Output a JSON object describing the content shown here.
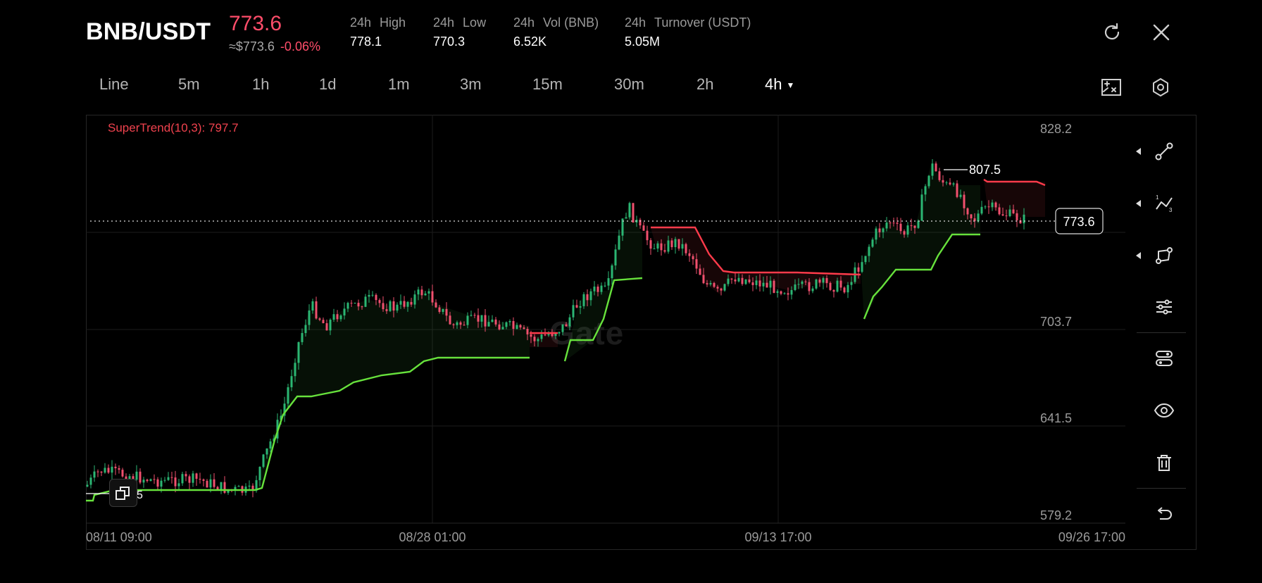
{
  "header": {
    "pair": "BNB/USDT",
    "price": "773.6",
    "approx": "≈$773.6",
    "change": "-0.06%",
    "stats": [
      {
        "period": "24h",
        "label": "High",
        "value": "778.1"
      },
      {
        "period": "24h",
        "label": "Low",
        "value": "770.3"
      },
      {
        "period": "24h",
        "label": "Vol (BNB)",
        "value": "6.52K"
      },
      {
        "period": "24h",
        "label": "Turnover (USDT)",
        "value": "5.05M"
      }
    ],
    "icons": {
      "rotate": "rotate-icon",
      "close": "close-icon"
    }
  },
  "toolbar": {
    "tabs": [
      "Line",
      "5m",
      "1h",
      "1d",
      "1m",
      "3m",
      "15m",
      "30m",
      "2h",
      "4h"
    ],
    "active_tab": "4h",
    "icons": {
      "fullscreen": "chart-layout-icon",
      "settings": "hexagon-settings-icon"
    }
  },
  "chart": {
    "indicator_label": "SuperTrend(10,3): 797.7",
    "price_axis": [
      "828.2",
      "703.7",
      "641.5",
      "579.2"
    ],
    "time_axis": [
      "08/11 09:00",
      "08/28 01:00",
      "09/13 17:00",
      "09/26 17:00"
    ],
    "current_price_tag": "773.6",
    "high_marker": "807.5",
    "low_marker_suffix": "5",
    "watermark": "Gate",
    "colors": {
      "up": "#2bb673",
      "down": "#f0506e",
      "supertrend_up": "#67e23c",
      "supertrend_down": "#ff3b4b",
      "accent_red": "#ff4d6a"
    }
  },
  "right_tools": [
    {
      "name": "trend-line-tool-icon",
      "has_submenu": true
    },
    {
      "name": "fib-tool-icon",
      "has_submenu": true
    },
    {
      "name": "shape-tool-icon",
      "has_submenu": true
    },
    {
      "name": "indicator-sliders-icon",
      "has_submenu": false
    },
    {
      "name": "drawing-settings-icon",
      "has_submenu": false
    },
    {
      "name": "visibility-eye-icon",
      "has_submenu": false
    },
    {
      "name": "delete-trash-icon",
      "has_submenu": false
    },
    {
      "name": "undo-icon",
      "has_submenu": false
    }
  ]
}
